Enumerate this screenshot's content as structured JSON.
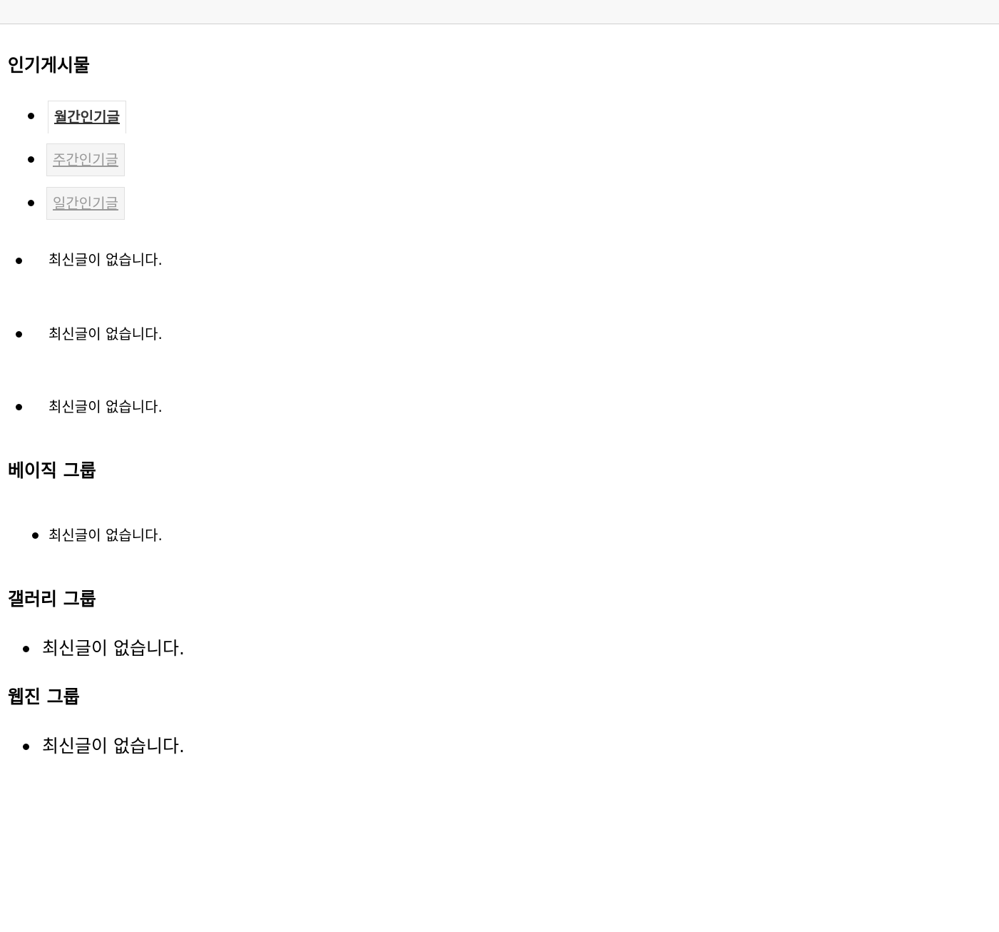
{
  "popular": {
    "title": "인기게시물",
    "tabs": [
      {
        "label": "월간인기글",
        "active": true
      },
      {
        "label": "주간인기글",
        "active": false
      },
      {
        "label": "일간인기글",
        "active": false
      }
    ],
    "panels": [
      {
        "empty_text": "최신글이 없습니다."
      },
      {
        "empty_text": "최신글이 없습니다."
      },
      {
        "empty_text": "최신글이 없습니다."
      }
    ]
  },
  "basic_group": {
    "title": "베이직 그룹",
    "empty_text": "최신글이 없습니다."
  },
  "gallery_group": {
    "title": "갤러리 그룹",
    "empty_text": "최신글이 없습니다."
  },
  "webzine_group": {
    "title": "웹진 그룹",
    "empty_text": "최신글이 없습니다."
  }
}
